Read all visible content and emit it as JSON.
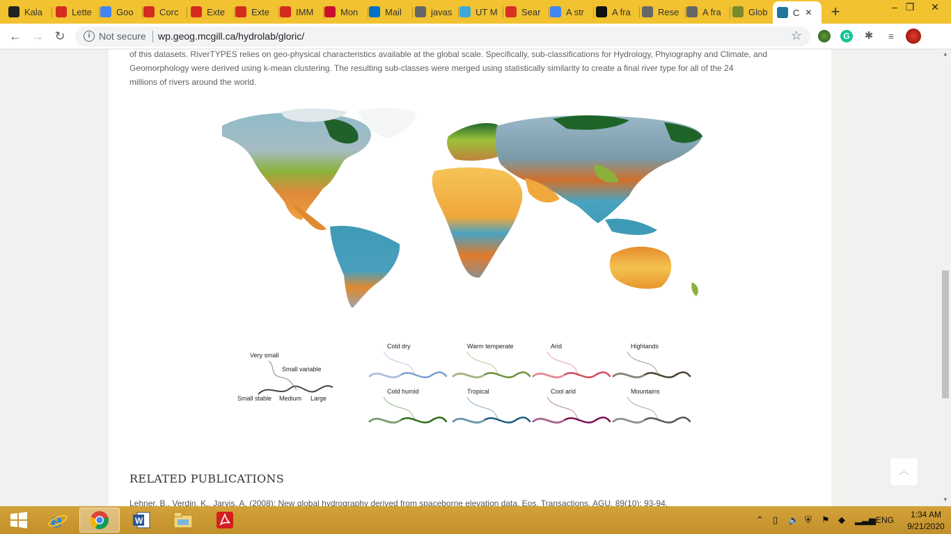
{
  "browser": {
    "tabs": [
      {
        "label": "Kala",
        "icon": "kaggle-icon",
        "color": "#222222"
      },
      {
        "label": "Lette",
        "icon": "canada-icon",
        "color": "#d52b1e"
      },
      {
        "label": "Goo",
        "icon": "google-translate-icon",
        "color": "#4285f4"
      },
      {
        "label": "Corc",
        "icon": "maple-leaf-icon",
        "color": "#d52b1e"
      },
      {
        "label": "Exte",
        "icon": "maple-leaf-icon",
        "color": "#d52b1e"
      },
      {
        "label": "Exte",
        "icon": "maple-leaf-icon",
        "color": "#d52b1e"
      },
      {
        "label": "IMM",
        "icon": "maple-leaf-icon",
        "color": "#d52b1e"
      },
      {
        "label": "Mon",
        "icon": "monster-icon",
        "color": "#c8102e"
      },
      {
        "label": "Mail",
        "icon": "outlook-icon",
        "color": "#0072c6"
      },
      {
        "label": "javas",
        "icon": "globe-icon",
        "color": "#666666"
      },
      {
        "label": "UT M",
        "icon": "ut-icon",
        "color": "#3ea8d8"
      },
      {
        "label": "Sear",
        "icon": "gmail-icon",
        "color": "#d93025"
      },
      {
        "label": "A str",
        "icon": "google-icon",
        "color": "#4285f4"
      },
      {
        "label": "A fra",
        "icon": "wiki-w-icon",
        "color": "#111111"
      },
      {
        "label": "Rese",
        "icon": "globe-icon",
        "color": "#666666"
      },
      {
        "label": "A fra",
        "icon": "globe-icon",
        "color": "#666666"
      },
      {
        "label": "Glob",
        "icon": "upsd-icon",
        "color": "#7a8a2a"
      },
      {
        "label": "C",
        "icon": "wordpress-icon",
        "color": "#21759b",
        "active": true
      }
    ],
    "new_tab": "+",
    "window_controls": {
      "minimize": "–",
      "restore": "❐",
      "close": "✕"
    },
    "security_label": "Not secure",
    "url": "wp.geog.mcgill.ca/hydrolab/gloric/",
    "theme_color": "#f2c230"
  },
  "page": {
    "paragraph_lines": [
      "of this datasets. RiverTYPES relies on geo-physical characteristics available at the global scale. Specifically, sub-classifications for Hydrology, Phyiography and Climate, and",
      "Geomorphology were derived using k-mean clustering. The resulting sub-classes were merged using statistically similarity to create a final river type for all of the 24",
      " millions of rivers around the world."
    ],
    "legend": {
      "size": {
        "labels": [
          "Very small",
          "Small variable",
          "Small stable",
          "Medium",
          "Large"
        ]
      },
      "climate_rows": [
        [
          {
            "label": "Cold dry",
            "color": "#7d9ed0"
          },
          {
            "label": "Warm temperate",
            "color": "#6e8f3a"
          },
          {
            "label": "Arid",
            "color": "#d24b5a"
          },
          {
            "label": "Highlands",
            "color": "#4a4030"
          }
        ],
        [
          {
            "label": "Cold humid",
            "color": "#2f6b1a"
          },
          {
            "label": "Tropical",
            "color": "#1d5a80"
          },
          {
            "label": "Cool arid",
            "color": "#7a1050"
          },
          {
            "label": "Mountains",
            "color": "#555555"
          }
        ]
      ]
    },
    "related_heading": "RELATED PUBLICATIONS",
    "publication_1": "Lehner, B., Verdin, K., Jarvis, A. (2008): New global hydrography derived from spaceborne elevation data. Eos, Transactions, AGU, 89(10): 93-94."
  },
  "taskbar": {
    "apps": [
      "windows-start-icon",
      "internet-explorer-icon",
      "chrome-icon",
      "word-icon",
      "file-explorer-icon",
      "acrobat-icon"
    ],
    "language": "ENG",
    "time": "1:34 AM",
    "date": "9/21/2020"
  }
}
